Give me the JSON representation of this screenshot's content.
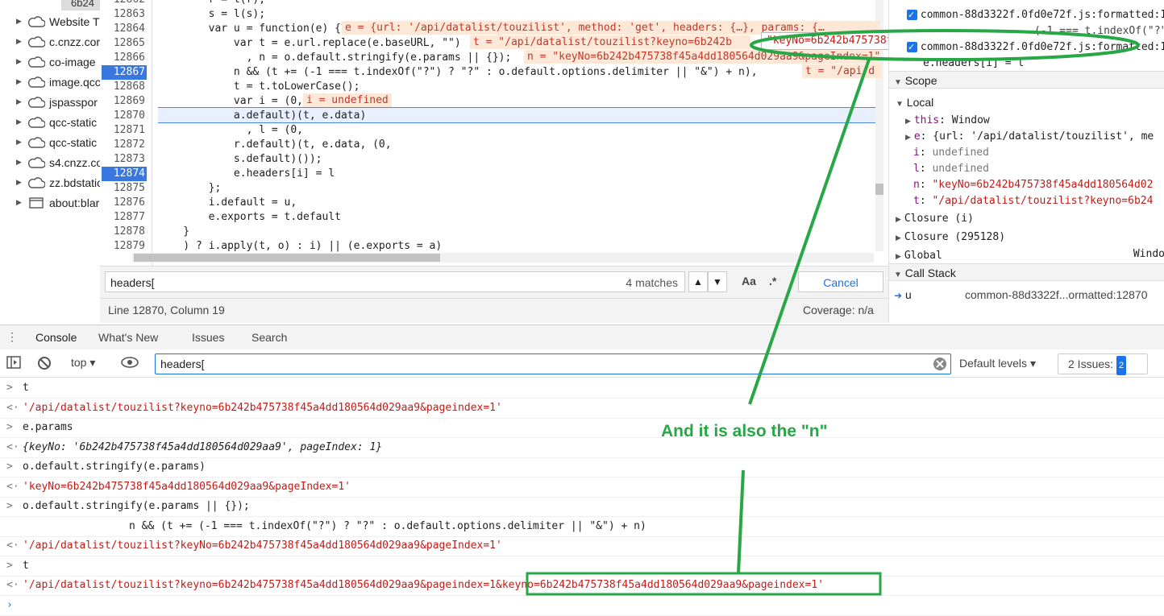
{
  "file_tree": {
    "top_chip": "6b24",
    "items": [
      {
        "label": "Website T",
        "icon": "cloud-icon"
      },
      {
        "label": "c.cnzz.cor",
        "icon": "cloud-icon"
      },
      {
        "label": "co-image",
        "icon": "cloud-icon"
      },
      {
        "label": "image.qcc",
        "icon": "cloud-icon"
      },
      {
        "label": "jspasspor",
        "icon": "cloud-icon"
      },
      {
        "label": "qcc-static",
        "icon": "cloud-icon"
      },
      {
        "label": "qcc-static",
        "icon": "cloud-icon"
      },
      {
        "label": "s4.cnzz.co",
        "icon": "cloud-icon"
      },
      {
        "label": "zz.bdstatic",
        "icon": "cloud-icon"
      },
      {
        "label": "about:blar",
        "icon": "frame-icon"
      }
    ]
  },
  "editor": {
    "line_numbers": [
      "12862",
      "12863",
      "12864",
      "12865",
      "12866",
      "12867",
      "12868",
      "12869",
      "12870",
      "12871",
      "12872",
      "12873",
      "12874",
      "12875",
      "12876",
      "12877",
      "12878",
      "12879"
    ],
    "breakpoints": [
      "12867",
      "12874"
    ],
    "lines": [
      "        r = l(r);",
      "        s = l(s);",
      "        var u = function(e) {",
      "            var t = e.url.replace(e.baseURL, \"\")",
      "              , n = o.default.stringify(e.params || {});",
      "            n && (t += (-1 === t.indexOf(\"?\") ? \"?\" : o.default.options.delimiter || \"&\") + n),",
      "            t = t.toLowerCase();",
      "            var i = (0,",
      "            a.default)(t, e.data)",
      "              , l = (0,",
      "            r.default)(t, e.data, (0,",
      "            s.default)());",
      "            e.headers[i] = l",
      "        };",
      "        i.default = u,",
      "        e.exports = t.default",
      "    }",
      "    ) ? i.apply(t, o) : i) || (e.exports = a)"
    ],
    "inline_values": {
      "line_12864": "e = {url: '/api/datalist/touzilist', method: 'get', headers: {…}, params: {…",
      "line_12865": "t = \"/api/datalist/touzilist?keyno=6b242b",
      "line_12866": "n = \"keyNo=6b242b475738f45a4dd180564d029aa9&pageIndex=1\"",
      "line_12867": "t = \"/api/d",
      "line_12869": "i = undefined"
    },
    "tooltip": "\"keyNo=6b242b475738f45a4dd180564d029aa9&pageIndex=1\""
  },
  "search": {
    "value": "headers[",
    "matches": "4 matches",
    "match_case": "Aa",
    "regex": ".*",
    "cancel": "Cancel"
  },
  "status": {
    "position": "Line 12870, Column 19",
    "coverage": "Coverage: n/a"
  },
  "right_panel": {
    "breakpoints": [
      "common-88d3322f.0fd0e72f.js:formatted:12...",
      "(-1 === t.indexOf(\"?\") ? ...",
      "common-88d3322f.0fd0e72f.js:formatted:12...",
      "e.headers[i] = l"
    ],
    "scope_title": "Scope",
    "local_title": "Local",
    "local_vars": [
      {
        "name": "this",
        "value": "Window",
        "kind": "plain"
      },
      {
        "name": "e",
        "value": "{url: '/api/datalist/touzilist', me",
        "kind": "plain"
      },
      {
        "name": "i",
        "value": "undefined",
        "kind": "undef"
      },
      {
        "name": "l",
        "value": "undefined",
        "kind": "undef"
      },
      {
        "name": "n",
        "value": "\"keyNo=6b242b475738f45a4dd180564d02",
        "kind": "str"
      },
      {
        "name": "t",
        "value": "\"/api/datalist/touzilist?keyno=6b24",
        "kind": "str"
      }
    ],
    "closures": [
      "Closure (i)",
      "Closure (295128)"
    ],
    "global_label": "Global",
    "global_value": "Windo",
    "call_stack_title": "Call Stack",
    "call_stack": [
      {
        "fn": "u",
        "location": "common-88d3322f...ormatted:12870"
      }
    ]
  },
  "drawer": {
    "tabs": [
      "Console",
      "What's New",
      "Issues",
      "Search"
    ],
    "active_tab": "Console",
    "context": "top",
    "filter": "headers[",
    "levels": "Default levels",
    "issues_label": "2 Issues:",
    "issues_count": "2"
  },
  "console": [
    {
      "type": "input",
      "text": "t"
    },
    {
      "type": "result",
      "text": "'/api/datalist/touzilist?keyno=6b242b475738f45a4dd180564d029aa9&pageindex=1'"
    },
    {
      "type": "input",
      "text": "e.params"
    },
    {
      "type": "object",
      "text": "{keyNo: '6b242b475738f45a4dd180564d029aa9', pageIndex: 1}"
    },
    {
      "type": "input",
      "text": "o.default.stringify(e.params)"
    },
    {
      "type": "result",
      "text": "'keyNo=6b242b475738f45a4dd180564d029aa9&pageIndex=1'"
    },
    {
      "type": "input",
      "text": "o.default.stringify(e.params || {});"
    },
    {
      "type": "continuation",
      "text": "n && (t += (-1 === t.indexOf(\"?\") ? \"?\" : o.default.options.delimiter || \"&\") + n)"
    },
    {
      "type": "result",
      "text": "'/api/datalist/touzilist?keyNo=6b242b475738f45a4dd180564d029aa9&pageIndex=1'"
    },
    {
      "type": "input",
      "text": "t"
    },
    {
      "type": "result",
      "text": "'/api/datalist/touzilist?keyno=6b242b475738f45a4dd180564d029aa9&pageindex=1&keyno=6b242b475738f45a4dd180564d029aa9&pageindex=1'"
    }
  ],
  "annotation": {
    "text": "And it is also the \"n\"",
    "color": "#27a745"
  }
}
